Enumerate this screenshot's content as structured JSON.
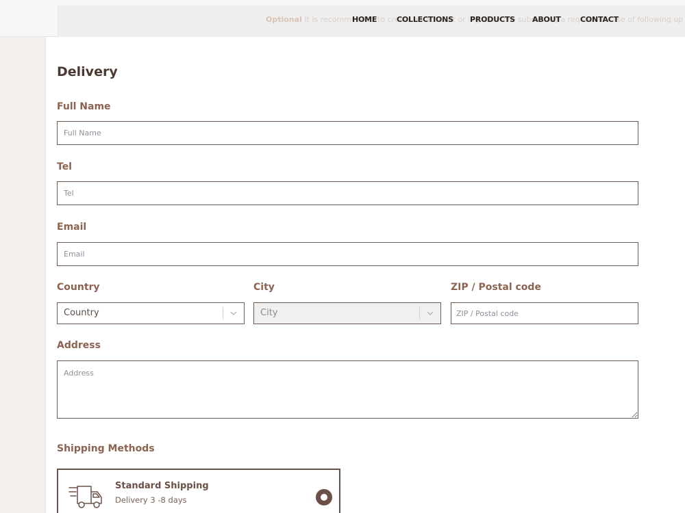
{
  "header": {
    "notice_strong": "Optional",
    "notice_text": "It is recommended to create an account or log in before submitting a request in case of following up on order"
  },
  "nav": [
    {
      "label": "HOME"
    },
    {
      "label": "COLLECTIONS"
    },
    {
      "label": "PRODUCTS"
    },
    {
      "label": "ABOUT"
    },
    {
      "label": "CONTACT"
    }
  ],
  "form": {
    "title": "Delivery",
    "full_name": {
      "label": "Full Name",
      "placeholder": "Full Name",
      "value": ""
    },
    "tel": {
      "label": "Tel",
      "placeholder": "Tel",
      "value": ""
    },
    "email": {
      "label": "Email",
      "placeholder": "Email",
      "value": ""
    },
    "country": {
      "label": "Country",
      "selected": "Country"
    },
    "city": {
      "label": "City",
      "selected": "City",
      "disabled": true
    },
    "zip": {
      "label": "ZIP / Postal code",
      "placeholder": "ZIP / Postal code",
      "value": ""
    },
    "address": {
      "label": "Address",
      "placeholder": "Address",
      "value": ""
    }
  },
  "shipping": {
    "title": "Shipping Methods",
    "methods": [
      {
        "name": "Standard Shipping",
        "eta": "Delivery 3 -8 days",
        "selected": true,
        "icon": "truck-icon"
      }
    ]
  },
  "colors": {
    "accent": "#6b5048",
    "label": "#8b6350",
    "border": "#6b5a50",
    "sidebar": "#f4efec"
  }
}
